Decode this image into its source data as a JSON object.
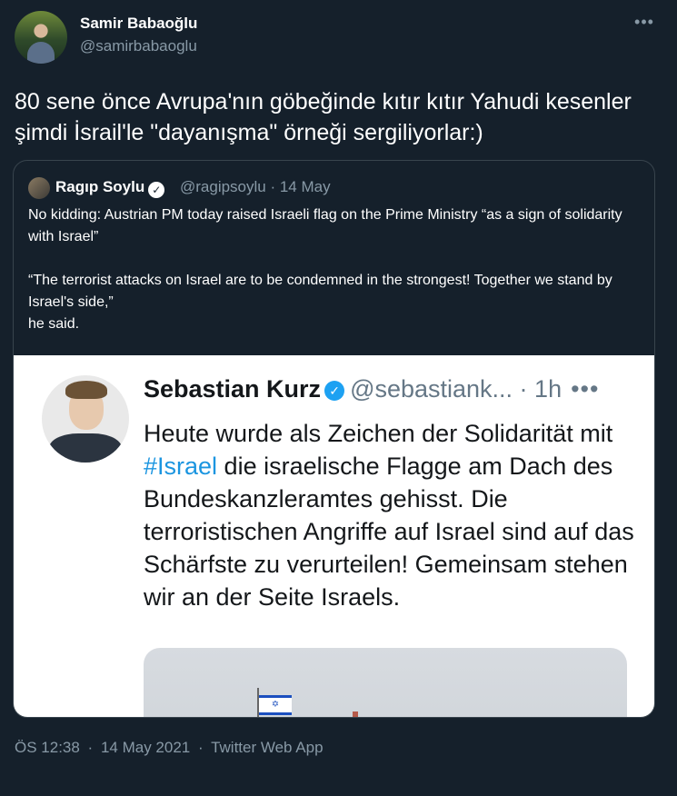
{
  "author": {
    "display_name": "Samir Babaoğlu",
    "handle": "@samirbabaoglu"
  },
  "more_icon": "ellipsis-icon",
  "tweet_text": "80 sene önce Avrupa'nın göbeğinde kıtır kıtır Yahudi kesenler şimdi İsrail'le \"dayanışma\" örneği sergiliyorlar:)",
  "quoted": {
    "display_name": "Ragıp Soylu",
    "handle_date": "@ragipsoylu · 14 May",
    "text": "No kidding: Austrian PM today raised Israeli flag on the Prime Ministry “as a sign of solidarity with Israel”\n\n“The terrorist attacks on Israel are to be condemned in the strongest! Together we stand by Israel's side,”\nhe said.",
    "embedded_image": {
      "name": "Sebastian Kurz",
      "handle_time": "@sebastiank... · 1h",
      "more": "•••",
      "text_before": "Heute wurde als Zeichen der Solidarität mit ",
      "hashtag": "#Israel",
      "text_after": " die israelische Flagge am Dach des Bundeskanzleramtes gehisst. Die terroristischen Angriffe auf Israel sind auf das Schärfste zu verurteilen! Gemeinsam stehen wir an der Seite Israels."
    }
  },
  "meta": {
    "time": "ÖS 12:38",
    "date": "14 May 2021",
    "source": "Twitter Web App"
  },
  "colors": {
    "background": "#15202b",
    "secondary_text": "#8899a6",
    "border": "#38444d",
    "link": "#1b95e0"
  }
}
